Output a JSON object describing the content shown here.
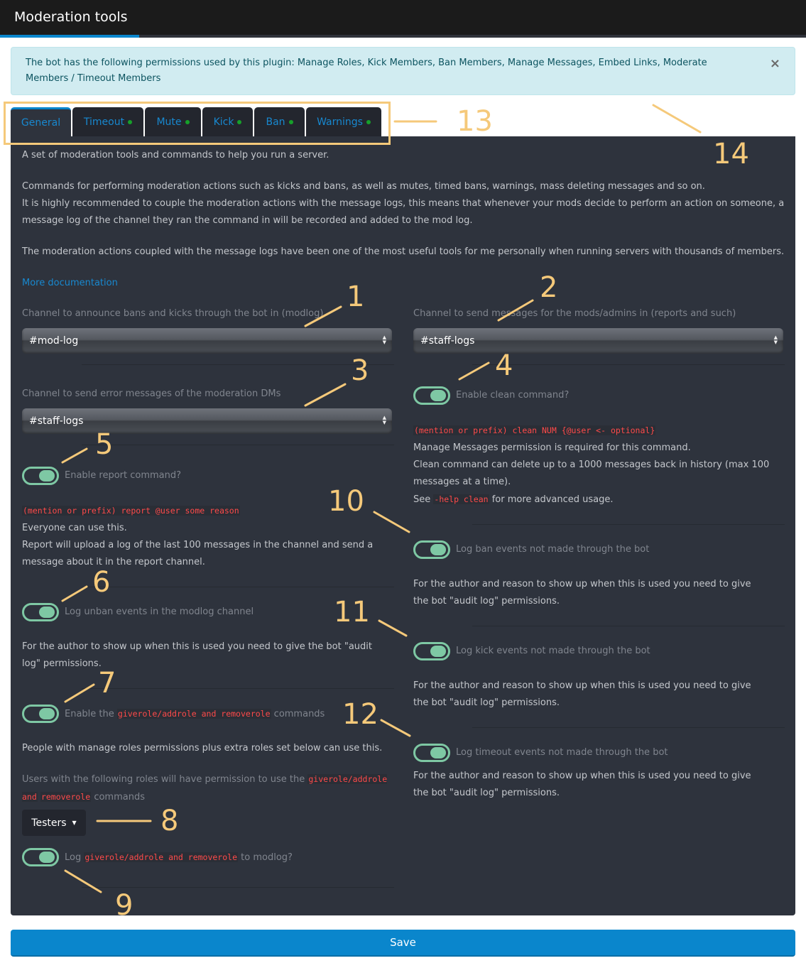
{
  "header": {
    "title": "Moderation tools"
  },
  "alert": {
    "text": "The bot has the following permissions used by this plugin: Manage Roles, Kick Members, Ban Members, Manage Messages, Embed Links, Moderate Members / Timeout Members",
    "close_icon": "×"
  },
  "tabs": [
    {
      "label": "General",
      "active": true,
      "status_dot": false
    },
    {
      "label": "Timeout",
      "active": false,
      "status_dot": true
    },
    {
      "label": "Mute",
      "active": false,
      "status_dot": true
    },
    {
      "label": "Kick",
      "active": false,
      "status_dot": true
    },
    {
      "label": "Ban",
      "active": false,
      "status_dot": true
    },
    {
      "label": "Warnings",
      "active": false,
      "status_dot": true
    }
  ],
  "intro": {
    "p1": "A set of moderation tools and commands to help you run a server.",
    "p2a": "Commands for performing moderation actions such as kicks and bans, as well as mutes, timed bans, warnings, mass deleting messages and so on.",
    "p2b": "It is highly recommended to couple the moderation actions with the message logs, this means that whenever your mods decide to perform an action on someone, a message log of the channel they ran the command in will be recorded and added to the mod log.",
    "p3": "The moderation actions coupled with the message logs have been one of the most useful tools for me personally when running servers with thousands of members.",
    "doc_link": "More documentation"
  },
  "left": {
    "modlog_label": "Channel to announce bans and kicks through the bot in (modlog)",
    "modlog_value": "#mod-log",
    "error_label": "Channel to send error messages of the moderation DMs",
    "error_value": "#staff-logs",
    "report_toggle": {
      "label": "Enable report command?",
      "on": true
    },
    "report_code": "(mention or prefix) report @user some reason",
    "report_desc1": "Everyone can use this.",
    "report_desc2": "Report will upload a log of the last 100 messages in the channel and send a message about it in the report channel.",
    "unban_toggle": {
      "label": "Log unban events in the modlog channel",
      "on": true
    },
    "unban_desc": "For the author to show up when this is used you need to give the bot \"audit log\" permissions.",
    "giverole_toggle": {
      "pre": "Enable the",
      "code": "giverole/addrole and removerole",
      "post": "commands",
      "on": true
    },
    "giverole_desc": "People with manage roles permissions plus extra roles set below can use this.",
    "roles_label_pre": "Users with the following roles will have permission to use the",
    "roles_label_code1": "giverole/addrole and",
    "roles_label_code2": "removerole",
    "roles_label_post": "commands",
    "roles_dropdown": "Testers",
    "log_giverole_toggle": {
      "pre": "Log",
      "code": "giverole/addrole and removerole",
      "post": "to modlog?",
      "on": true
    }
  },
  "right": {
    "mods_label": "Channel to send messages for the mods/admins in (reports and such)",
    "mods_value": "#staff-logs",
    "clean_toggle": {
      "label": "Enable clean command?",
      "on": true
    },
    "clean_code": "(mention or prefix) clean NUM {@user <- optional}",
    "clean_desc1": "Manage Messages permission is required for this command.",
    "clean_desc2": "Clean command can delete up to a 1000 messages back in history (max 100 messages at a time).",
    "clean_see_pre": "See",
    "clean_see_code": "-help clean",
    "clean_see_post": "for more advanced usage.",
    "ban_toggle": {
      "label": "Log ban events not made through the bot",
      "on": true
    },
    "ban_desc": "For the author and reason to show up when this is used you need to give the bot \"audit log\" permissions.",
    "kick_toggle": {
      "label": "Log kick events not made through the bot",
      "on": true
    },
    "kick_desc": "For the author and reason to show up when this is used you need to give the bot \"audit log\" permissions.",
    "timeout_toggle": {
      "label": "Log timeout events not made through the bot",
      "on": true
    },
    "timeout_desc": "For the author and reason to show up when this is used you need to give the bot \"audit log\" permissions."
  },
  "save_label": "Save",
  "annotations": [
    "1",
    "2",
    "3",
    "4",
    "5",
    "6",
    "7",
    "8",
    "9",
    "10",
    "11",
    "12",
    "13",
    "14"
  ],
  "colors": {
    "accent": "#0a86cc",
    "toggle_on": "#7ec8a4",
    "code_red": "#ff4a4a",
    "annotation": "#f5c97a",
    "panel_bg": "#2e333d"
  }
}
